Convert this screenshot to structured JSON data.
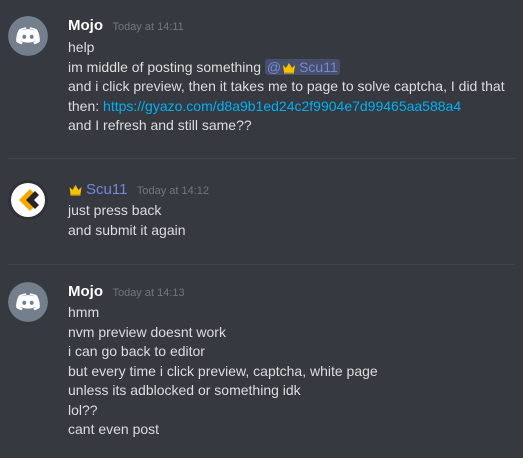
{
  "colors": {
    "background": "#36393f",
    "discord_blurple": "#7289da",
    "link": "#00b0f4",
    "timestamp": "#72767d",
    "crown": "#f5c400"
  },
  "messages": [
    {
      "author": "Mojo",
      "timestamp": "Today at 14:11",
      "avatar_icon": "discord-logo-icon",
      "lines": {
        "l1": "help",
        "l2_prefix": "im middle of posting something ",
        "l2_mention_at": "@",
        "l2_mention_name": "Scu11",
        "l3": "and i click preview, then it takes me to page to solve captcha, I did that",
        "l4_prefix": "then: ",
        "l4_link": "https://gyazo.com/d8a9b1ed24c2f9904e7d99465aa588a4",
        "l5": "and I refresh and still same??"
      }
    },
    {
      "author": "Scu11",
      "timestamp": "Today at 14:12",
      "avatar_icon": "chevron-logo-icon",
      "name_icon": "crown-icon",
      "lines": {
        "l1": "just press back",
        "l2": "and submit it again"
      }
    },
    {
      "author": "Mojo",
      "timestamp": "Today at 14:13",
      "avatar_icon": "discord-logo-icon",
      "lines": {
        "l1": "hmm",
        "l2": "nvm preview doesnt work",
        "l3": "i can go back to editor",
        "l4": "but every time i click preview, captcha, white page",
        "l5": "unless its adblocked or something idk",
        "l6": "lol??",
        "l7": "cant even post"
      }
    }
  ]
}
